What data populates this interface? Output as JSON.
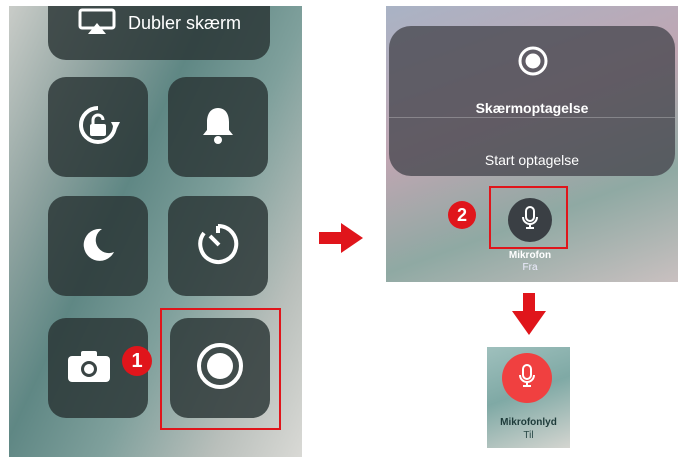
{
  "left_panel": {
    "mirror_label": "Dubler skærm",
    "badge_number": "1"
  },
  "right_panel": {
    "menu_title": "Skærmoptagelse",
    "start_label": "Start optagelse",
    "badge_number": "2",
    "mic_title": "Mikrofon",
    "mic_state": "Fra"
  },
  "bottom_panel": {
    "mic_title": "Mikrofonlyd",
    "mic_state": "Til"
  },
  "colors": {
    "highlight": "#e0151b",
    "mic_on": "#f04040",
    "mic_off": "#3a3f44"
  },
  "icons": [
    "screen-mirroring-icon",
    "rotation-lock-icon",
    "bell-icon",
    "moon-icon",
    "timer-icon",
    "camera-icon",
    "record-icon",
    "microphone-icon",
    "arrow-right-icon",
    "arrow-down-icon"
  ]
}
